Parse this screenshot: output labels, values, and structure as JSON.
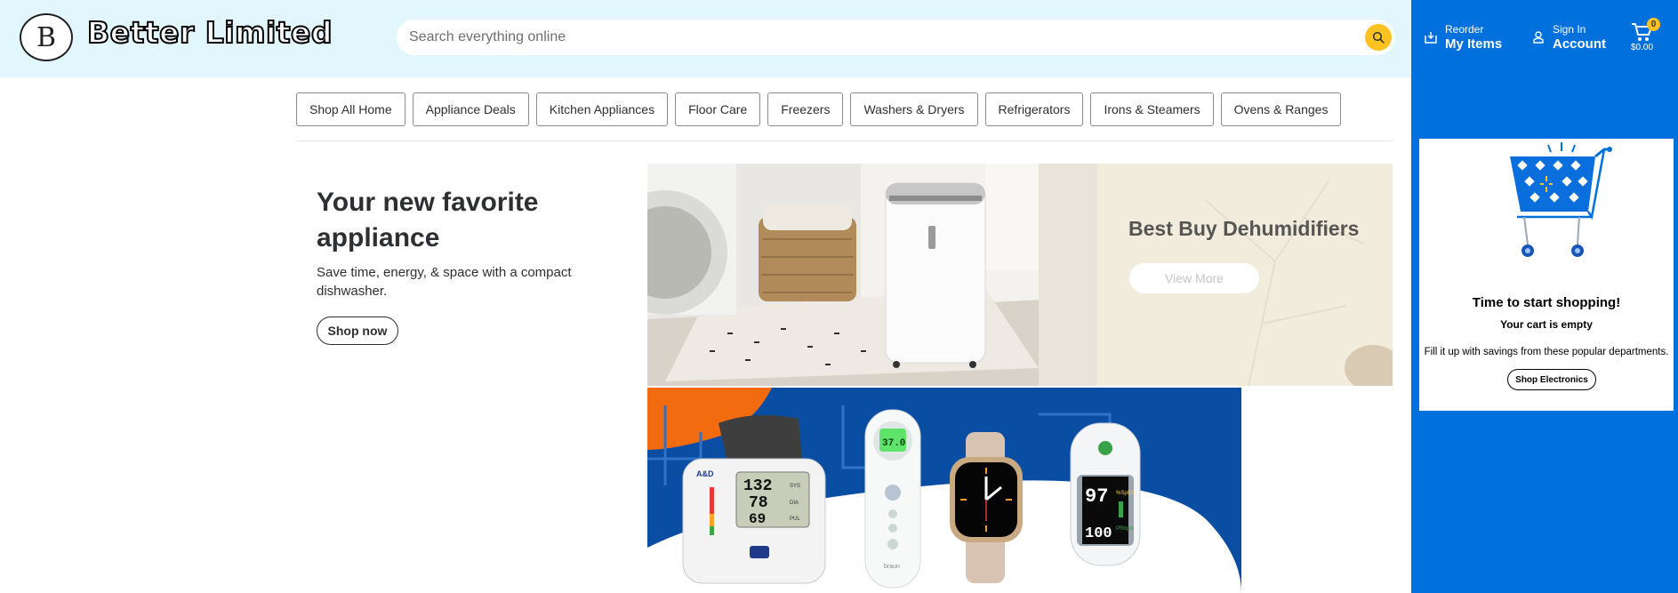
{
  "brand": {
    "logo_letter": "B",
    "name": "Better Limited"
  },
  "search": {
    "placeholder": "Search everything online",
    "value": "",
    "icon": "search-icon"
  },
  "account": {
    "reorder_small": "Reorder",
    "reorder_big": "My Items",
    "signin_small": "Sign In",
    "signin_big": "Account",
    "cart_count": "0",
    "cart_total": "$0.00"
  },
  "categories": [
    "Shop All Home",
    "Appliance Deals",
    "Kitchen Appliances",
    "Floor Care",
    "Freezers",
    "Washers & Dryers",
    "Refrigerators",
    "Irons & Steamers",
    "Ovens & Ranges"
  ],
  "hero": {
    "title": "Your new favorite appliance",
    "subtitle": "Save time, energy, & space with a compact dishwasher.",
    "button": "Shop now"
  },
  "banner1": {
    "title": "Best Buy Dehumidifiers",
    "button": "View More"
  },
  "banner2": {
    "bp_readings": [
      "132",
      "78",
      "69"
    ],
    "bp_units": [
      "SYS",
      "DIA",
      "PUL"
    ],
    "bp_brand": "A&D",
    "thermometer_reading": "37.0",
    "thermometer_brand": "braun",
    "oximeter_spo2": "97",
    "oximeter_pulse": "100",
    "oximeter_spo2_label": "%SpO2",
    "oximeter_pulse_label": "PRbpm"
  },
  "cart_panel": {
    "title": "Time to start shopping!",
    "subtitle": "Your cart is empty",
    "message": "Fill it up with savings from these popular departments.",
    "button": "Shop Electronics"
  },
  "colors": {
    "header_bg": "#e2f7fd",
    "primary_blue": "#0071dc",
    "accent_yellow": "#ffc220",
    "banner_cream": "#f1ecdc",
    "banner2_blue": "#0a4ea3",
    "banner2_orange": "#f26b0f"
  }
}
